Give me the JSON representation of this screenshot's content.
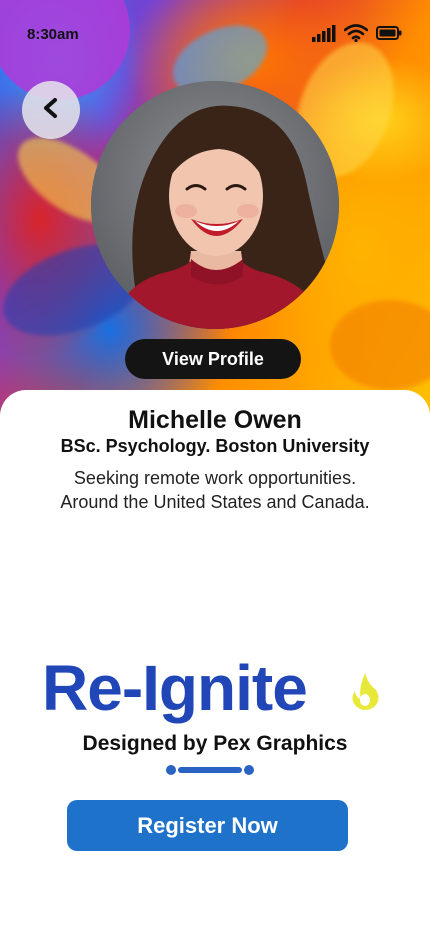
{
  "status_bar": {
    "time": "8:30am",
    "icons": [
      "signal-icon",
      "wifi-icon",
      "battery-icon"
    ]
  },
  "header": {
    "back_icon": "chevron-left-icon"
  },
  "profile": {
    "view_profile_label": "View Profile",
    "name": "Michelle Owen",
    "degree": "BSc. Psychology. Boston University",
    "bio_line1": "Seeking remote work opportunities.",
    "bio_line2": "Around the United States and Canada."
  },
  "brand": {
    "name": "Re-Ignite",
    "icon": "flame-icon",
    "tagline": "Designed by Pex Graphics"
  },
  "actions": {
    "register_label": "Register Now"
  },
  "colors": {
    "brand_blue": "#2046b7",
    "button_blue": "#1f72c9",
    "flame_yellow": "#e8e83a",
    "view_profile_bg": "#141414"
  }
}
